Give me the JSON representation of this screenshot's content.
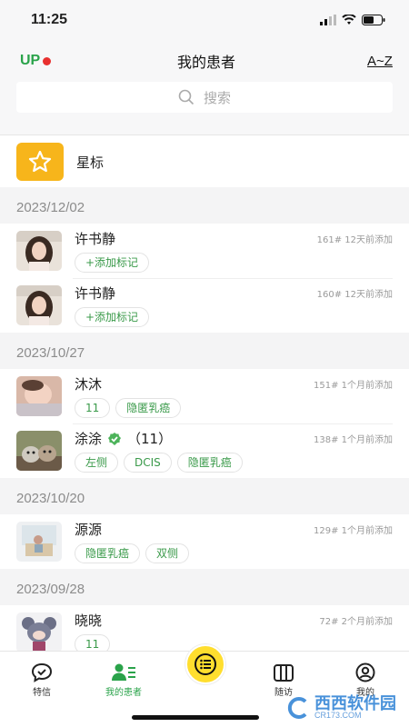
{
  "status": {
    "time": "11:25"
  },
  "header": {
    "logo_text": "UP",
    "title": "我的患者",
    "sort_label": "A~Z"
  },
  "search": {
    "placeholder": "搜索"
  },
  "starred": {
    "label": "星标"
  },
  "groups": [
    {
      "date": "2023/12/02",
      "patients": [
        {
          "name": "许书静",
          "meta": "161# 12天前添加",
          "tags": [
            "+添加标记"
          ]
        },
        {
          "name": "许书静",
          "meta": "160# 12天前添加",
          "tags": [
            "+添加标记"
          ]
        }
      ]
    },
    {
      "date": "2023/10/27",
      "patients": [
        {
          "name": "沐沐",
          "meta": "151# 1个月前添加",
          "tags": [
            "11",
            "隐匿乳癌"
          ]
        },
        {
          "name": "涂涂",
          "count": "（11）",
          "meta": "138# 1个月前添加",
          "tags": [
            "左侧",
            "DCIS",
            "隐匿乳癌"
          ]
        }
      ]
    },
    {
      "date": "2023/10/20",
      "patients": [
        {
          "name": "源源",
          "meta": "129# 1个月前添加",
          "tags": [
            "隐匿乳癌",
            "双侧"
          ]
        }
      ]
    },
    {
      "date": "2023/09/28",
      "patients": [
        {
          "name": "晓晓",
          "meta": "72# 2个月前添加",
          "tags": [
            "11"
          ]
        }
      ]
    }
  ],
  "tabs": [
    {
      "label": "特信"
    },
    {
      "label": "我的患者"
    },
    {
      "label": "随访"
    },
    {
      "label": "我的"
    }
  ],
  "watermark": {
    "brand": "西西软件园",
    "site": "CR173.COM"
  },
  "colors": {
    "accent": "#2aa34a",
    "star_tile": "#f7b51b",
    "center_button": "#ffde2e",
    "tag_text": "#3a9a4a"
  }
}
